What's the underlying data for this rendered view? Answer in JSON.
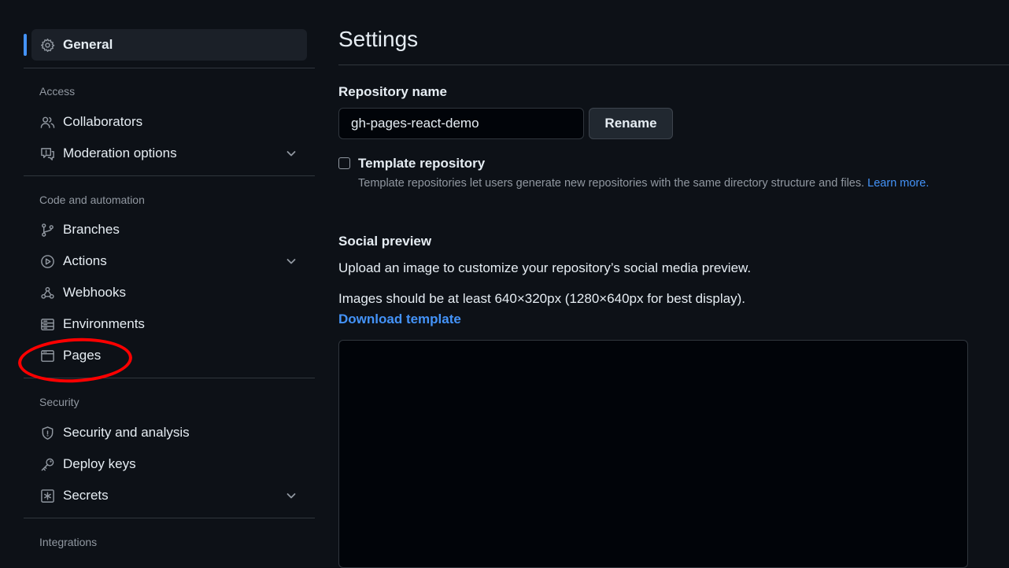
{
  "sidebar": {
    "general": {
      "label": "General",
      "icon": "gear-icon"
    },
    "sections": {
      "access": "Access",
      "code_automation": "Code and automation",
      "security": "Security",
      "integrations": "Integrations"
    },
    "items": {
      "collaborators": {
        "label": "Collaborators",
        "icon": "people-icon"
      },
      "moderation": {
        "label": "Moderation options",
        "icon": "comment-report-icon"
      },
      "branches": {
        "label": "Branches",
        "icon": "git-branch-icon"
      },
      "actions": {
        "label": "Actions",
        "icon": "play-icon"
      },
      "webhooks": {
        "label": "Webhooks",
        "icon": "webhook-icon"
      },
      "environments": {
        "label": "Environments",
        "icon": "server-icon"
      },
      "pages": {
        "label": "Pages",
        "icon": "browser-icon"
      },
      "security_analysis": {
        "label": "Security and analysis",
        "icon": "shield-icon"
      },
      "deploy_keys": {
        "label": "Deploy keys",
        "icon": "key-icon"
      },
      "secrets": {
        "label": "Secrets",
        "icon": "asterisk-icon"
      }
    }
  },
  "main": {
    "title": "Settings",
    "repo_name": {
      "label": "Repository name",
      "value": "gh-pages-react-demo",
      "rename_button": "Rename"
    },
    "template": {
      "label": "Template repository",
      "checked": false,
      "help": "Template repositories let users generate new repositories with the same directory structure and files.",
      "learn_more": "Learn more."
    },
    "social_preview": {
      "title": "Social preview",
      "description": "Upload an image to customize your repository’s social media preview.",
      "requirements": "Images should be at least 640×320px (1280×640px for best display).",
      "download_link": "Download template"
    }
  },
  "colors": {
    "background": "#0d1117",
    "accent": "#4493f8",
    "annotation": "#ff0000"
  }
}
